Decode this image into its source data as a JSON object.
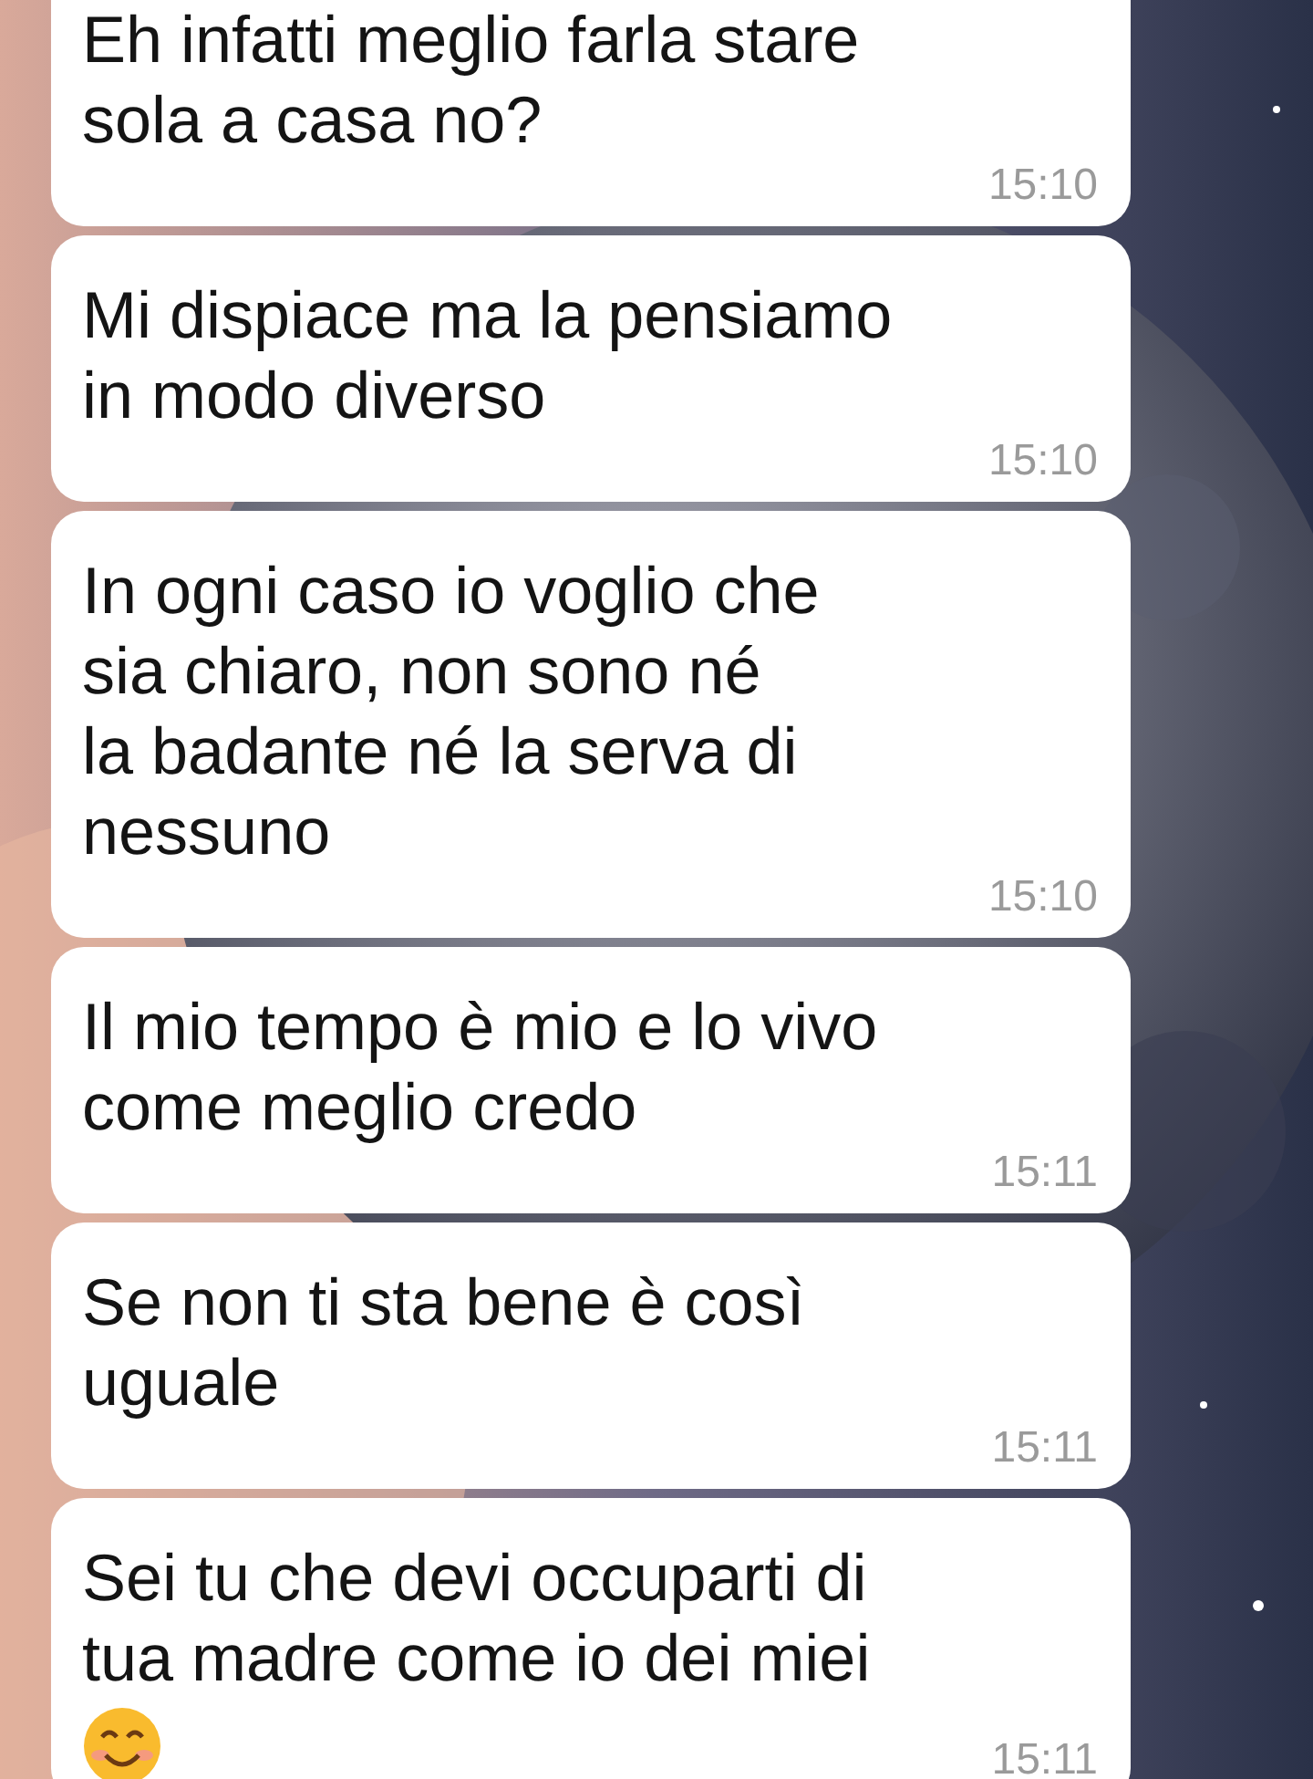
{
  "messages": [
    {
      "text": "Eh infatti meglio farla stare\nsola a casa no?",
      "time": "15:10"
    },
    {
      "text": "Mi dispiace ma la pensiamo\nin modo diverso",
      "time": "15:10"
    },
    {
      "text": "In ogni caso io voglio che\nsia chiaro, non sono né\nla badante né la serva di\nnessuno",
      "time": "15:10"
    },
    {
      "text": "Il mio tempo è mio e lo vivo\ncome meglio credo",
      "time": "15:11"
    },
    {
      "text": "Se non ti sta bene è così\nuguale",
      "time": "15:11"
    },
    {
      "text": "Sei tu che devi occuparti di\ntua madre come io dei miei",
      "time": "15:11",
      "emoji": true
    }
  ]
}
